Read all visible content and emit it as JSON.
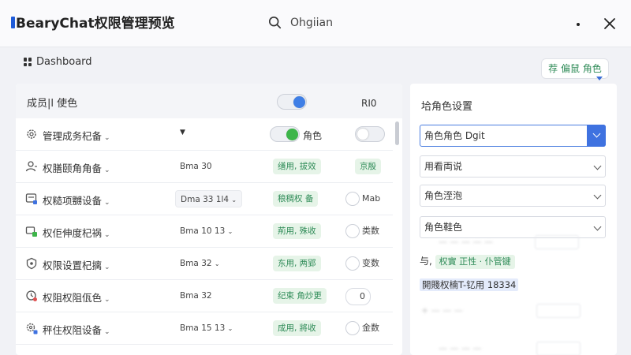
{
  "window": {
    "title": "BearyChat权限管理预览"
  },
  "search": {
    "value": "Ohgiian"
  },
  "dashboard": {
    "label": "Dashboard"
  },
  "role_button": {
    "label": "荐 偏鼠 角色"
  },
  "left_panel": {
    "header_title": "成员|l 使色",
    "header_right": "RI0",
    "rows": [
      {
        "name": "管理成务杞备",
        "select": "",
        "tag": "",
        "right_label": "角色",
        "right_type": "toggle"
      },
      {
        "name": "权膳颐角角备",
        "select": "Bma 30",
        "tag": "缮用, 拔效",
        "right_label": "京殷",
        "right_type": "pill"
      },
      {
        "name": "权糙项嬲设备",
        "select": "Dma 33 1l4",
        "tag": "稂稠权 备",
        "right_label": "Mab",
        "right_type": "radio"
      },
      {
        "name": "权佢伸度杞祸",
        "select": "Bma 10 13",
        "tag": "荊用, 殊收",
        "right_label": "类数",
        "right_type": "radio"
      },
      {
        "name": "权限设置杞摛",
        "select": "Bma 32",
        "tag": "东用, 两郢",
        "right_label": "变数",
        "right_type": "radio"
      },
      {
        "name": "权阻权阻佤色",
        "select": "Bma 32",
        "tag": "纪束 角炒更",
        "right_label": "0",
        "right_type": "radio"
      },
      {
        "name": "秤住权阻设备",
        "select": "Bma 15 13",
        "tag": "成用, 將收",
        "right_label": "金数",
        "right_type": "radio"
      }
    ]
  },
  "right_panel": {
    "title": "垥角色设置",
    "dropdowns": [
      "角色角色 Dgit",
      "用看両说",
      "角色洷泡",
      "角色鞋色"
    ],
    "line1_prefix": "与,",
    "line1_tag": "权實 正性 · 仆管键",
    "highlight_text": "開賤权楠T-钇用 18334"
  },
  "colors": {
    "accent_blue": "#3f72e0",
    "toggle_green": "#3db54a",
    "tag_green": "#2e8b57",
    "tag_bg": "#e6f4e8"
  },
  "icons": [
    "search-icon",
    "close-icon",
    "dashboard-grid-icon",
    "gear-icon",
    "user-icon",
    "role-icon",
    "lock-icon",
    "shield-icon",
    "clock-badge-icon",
    "settings-badge-icon"
  ]
}
